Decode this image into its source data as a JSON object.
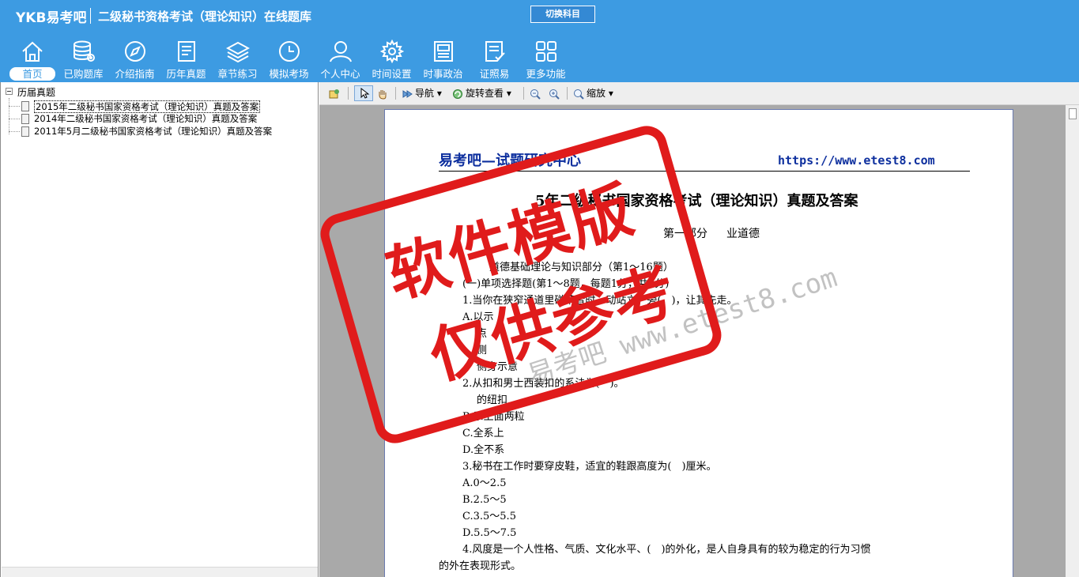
{
  "app": {
    "logo": "YKB易考吧",
    "title": "二级秘书资格考试（理论知识）在线题库",
    "switch_label": "切换科目"
  },
  "nav": [
    {
      "label": "首页",
      "icon": "home-icon",
      "active": true
    },
    {
      "label": "已购题库",
      "icon": "database-icon",
      "active": false
    },
    {
      "label": "介绍指南",
      "icon": "compass-icon",
      "active": false
    },
    {
      "label": "历年真题",
      "icon": "document-list-icon",
      "active": false
    },
    {
      "label": "章节练习",
      "icon": "layers-icon",
      "active": false
    },
    {
      "label": "模拟考场",
      "icon": "clock-icon",
      "active": false
    },
    {
      "label": "个人中心",
      "icon": "user-icon",
      "active": false
    },
    {
      "label": "时间设置",
      "icon": "gear-icon",
      "active": false
    },
    {
      "label": "时事政治",
      "icon": "newspaper-icon",
      "active": false
    },
    {
      "label": "证照易",
      "icon": "checklist-icon",
      "active": false
    },
    {
      "label": "更多功能",
      "icon": "grid-icon",
      "active": false
    }
  ],
  "tree": {
    "root": "历届真题",
    "items": [
      {
        "label": "2015年二级秘书国家资格考试（理论知识）真题及答案",
        "selected": true
      },
      {
        "label": "2014年二级秘书国家资格考试（理论知识）真题及答案",
        "selected": false
      },
      {
        "label": "2011年5月二级秘书国家资格考试（理论知识）真题及答案",
        "selected": false
      }
    ]
  },
  "toolbar": {
    "nav_label": "导航",
    "rotate_label": "旋转查看",
    "zoom_label": "缩放"
  },
  "document": {
    "header_left": "易考吧—试题研究中心",
    "header_right": "https://www.etest8.com",
    "title": "5年二级秘书国家资格考试（理论知识）真题及答案",
    "part": "第一部分",
    "part_suffix": "业道德",
    "lines": [
      "道德基础理论与知识部分（第1～16题）",
      "(一)单项选择题(第1～8题，每题1分，共8分)",
      "1.当你在狭窄通道里碰草者时，动站立一旁(　)，让其先走。",
      "A.以示",
      "点",
      "侧",
      "侧身示意",
      "2.从扣和男士西装扣的系法为(　)。",
      "的纽扣",
      "B.系上面两粒",
      "C.全系上",
      "D.全不系",
      "3.秘书在工作时要穿皮鞋，适宜的鞋跟高度为(　)厘米。",
      "A.0～2.5",
      "B.2.5～5",
      "C.3.5～5.5",
      "D.5.5～7.5",
      "4.风度是一个人性格、气质、文化水平、(　)的外化，是人自身具有的较为稳定的行为习惯",
      "的外在表现形式。"
    ]
  },
  "watermark": {
    "stamp_line1": "软件模版",
    "stamp_line2": "仅供参考",
    "text": "易考吧 www.etest8.com",
    "stamp_color": "#e01b1b"
  }
}
